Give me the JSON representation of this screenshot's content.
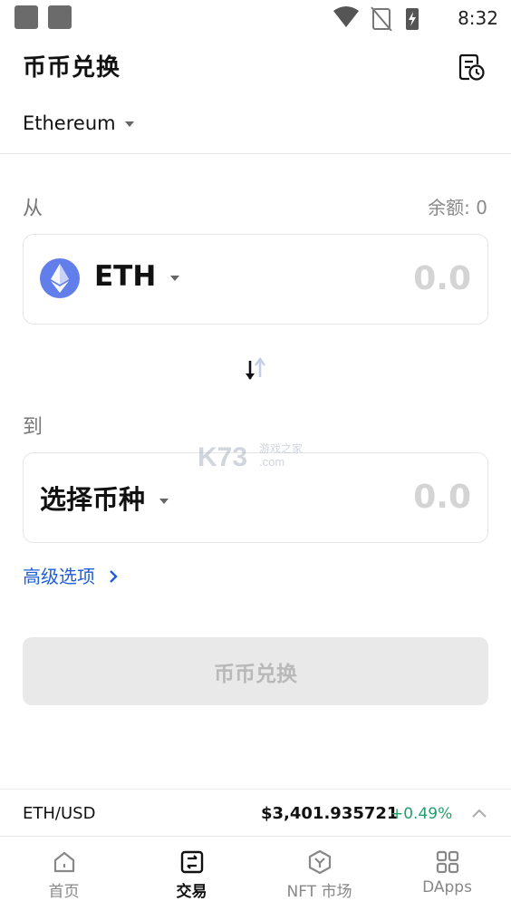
{
  "status_bar": {
    "time": "8:32"
  },
  "header": {
    "title": "币币兑换",
    "history_icon": "history-icon"
  },
  "network": {
    "selected": "Ethereum"
  },
  "from": {
    "label": "从",
    "balance": "余额: 0",
    "token": "ETH",
    "amount_placeholder": "0.0"
  },
  "swap_icon": "swap-icon",
  "to": {
    "label": "到",
    "token_placeholder": "选择币种",
    "amount_placeholder": "0.0"
  },
  "advanced": {
    "label": "高级选项"
  },
  "submit": {
    "label": "币币兑换"
  },
  "watermark": {
    "brand": "K73",
    "sub": "游戏之家",
    "domain": ".com"
  },
  "ticker": {
    "pair": "ETH/USD",
    "price": "$3,401.935721",
    "change": "+0.49%"
  },
  "colors": {
    "accent_blue": "#1f5fd6",
    "positive_green": "#22a06b",
    "eth_logo": "#627eea"
  },
  "bottom_nav": [
    {
      "label": "首页",
      "icon": "home-icon",
      "active": false
    },
    {
      "label": "交易",
      "icon": "trade-icon",
      "active": true
    },
    {
      "label": "NFT 市场",
      "icon": "nft-icon",
      "active": false
    },
    {
      "label": "DApps",
      "icon": "grid-icon",
      "active": false
    }
  ]
}
